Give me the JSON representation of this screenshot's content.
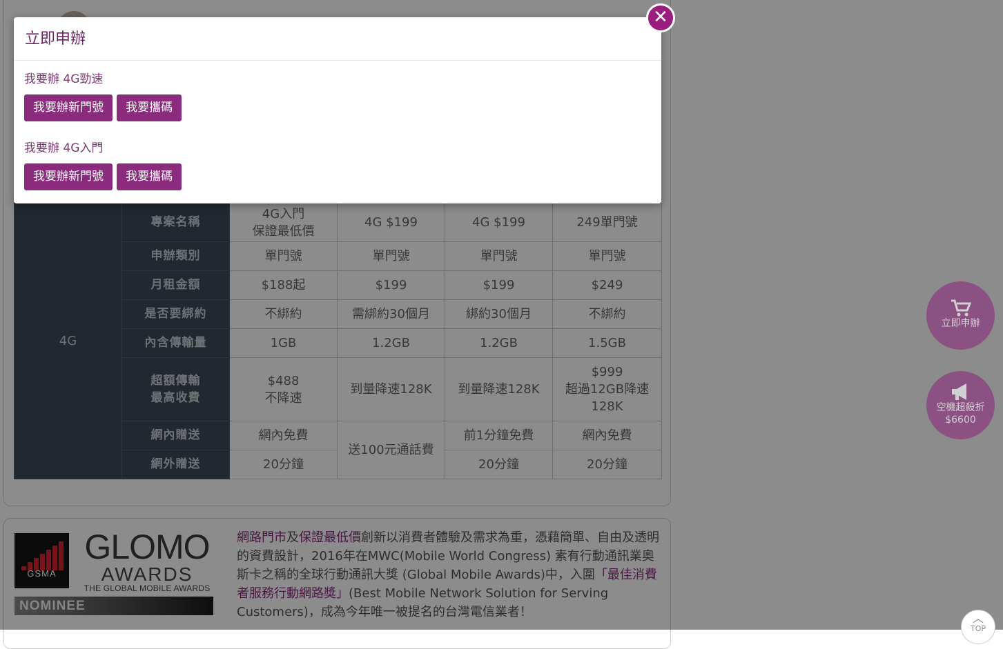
{
  "modal": {
    "title": "立即申辦",
    "close_symbol": "✕",
    "sections": [
      {
        "label": "我要辦 4G勁速",
        "buttons": [
          "我要辦新門號",
          "我要攜碼"
        ]
      },
      {
        "label": "我要辦 4G入門",
        "buttons": [
          "我要辦新門號",
          "我要攜碼"
        ]
      }
    ]
  },
  "plan_table": {
    "category": "4G",
    "row_headers": {
      "name": "專案名稱",
      "type": "申辦類別",
      "rent": "月租金額",
      "contract": "是否要綁約",
      "data": "內含傳輸量",
      "overage": [
        "超額傳輸",
        "最高收費"
      ],
      "onnet": "網內贈送",
      "offnet": "網外贈送"
    },
    "names": [
      [
        "4G入門",
        "保證最低價"
      ],
      [
        "4G $199"
      ],
      [
        "4G $199"
      ],
      [
        "249單門號"
      ]
    ],
    "types": [
      "單門號",
      "單門號",
      "單門號",
      "單門號"
    ],
    "rents": [
      "$188起",
      "$199",
      "$199",
      "$249"
    ],
    "contracts": [
      "不綁約",
      "需綁約30個月",
      "綁約30個月",
      "不綁約"
    ],
    "data": [
      "1GB",
      "1.2GB",
      "1.2GB",
      "1.5GB"
    ],
    "overage": [
      [
        "$488",
        "不降速"
      ],
      [
        "到量降速128K"
      ],
      [
        "到量降速128K"
      ],
      [
        "$999",
        "超過12GB降速",
        "128K"
      ]
    ],
    "onnet": [
      "網內免費",
      "前1分鐘免費",
      "網內免費"
    ],
    "offnet": [
      "20分鐘",
      "20分鐘",
      "20分鐘"
    ],
    "merged_call_credit": "送100元通話費"
  },
  "awards": {
    "gsma_logo_text": "GSMA",
    "glomo_line1": "GLOMO",
    "glomo_line2": "AWARDS",
    "glomo_line3": "THE GLOBAL MOBILE AWARDS",
    "nominee": "NOMINEE",
    "text_hl1": "網路門市",
    "text_1": "及",
    "text_hl2": "保證最低價",
    "text_2": "創新以消費者體驗及需求為重，憑藉簡單、自由及透明的資費設計，2016年在MWC(Mobile World Congress) 素有行動通訊業奧斯卡之稱的全球行動通訊大獎 (Global Mobile Awards)中，入圍",
    "text_hl3": "「最佳消費者服務行動網路獎」",
    "text_3": "(Best Mobile Network Solution for Serving Customers)，成為今年唯一被提名的台灣電信業者！"
  },
  "floating": {
    "apply_label": "立即申辦",
    "promo_line1": "空機超殺折",
    "promo_line2": "$6600",
    "top_label": "TOP"
  },
  "colors": {
    "brand_purple": "#8a2b7d",
    "table_header": "#3d4a58",
    "overlay": "rgba(0,0,0,0.45)"
  },
  "icons": [
    "cart-icon",
    "megaphone-icon",
    "close-icon",
    "chevron-up-icon"
  ]
}
